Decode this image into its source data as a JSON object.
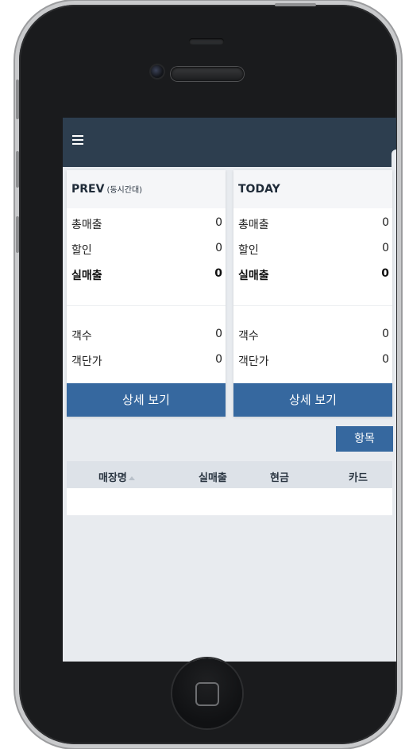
{
  "header": {
    "menu_icon": "hamburger-menu-icon",
    "bg_color": "#2d3e4f"
  },
  "cards": {
    "prev": {
      "title": "PREV",
      "subtitle": "(동시간대)",
      "rows": [
        {
          "label": "총매출",
          "value": "0"
        },
        {
          "label": "할인",
          "value": "0"
        },
        {
          "label": "실매출",
          "value": "0"
        },
        {
          "label": "객수",
          "value": "0"
        },
        {
          "label": "객단가",
          "value": "0"
        }
      ],
      "button_label": "상세 보기"
    },
    "today": {
      "title": "TODAY",
      "rows": [
        {
          "label": "총매출",
          "value": "0"
        },
        {
          "label": "할인",
          "value": "0"
        },
        {
          "label": "실매출",
          "value": "0"
        },
        {
          "label": "객수",
          "value": "0"
        },
        {
          "label": "객단가",
          "value": "0"
        }
      ],
      "button_label": "상세 보기"
    }
  },
  "items_button": {
    "label": "항목"
  },
  "table": {
    "columns": [
      "매장명",
      "실매출",
      "현금",
      "카드"
    ],
    "sort_icon": "sort-up-icon",
    "rows": []
  },
  "colors": {
    "accent": "#36689f",
    "background": "#e8ebef"
  }
}
